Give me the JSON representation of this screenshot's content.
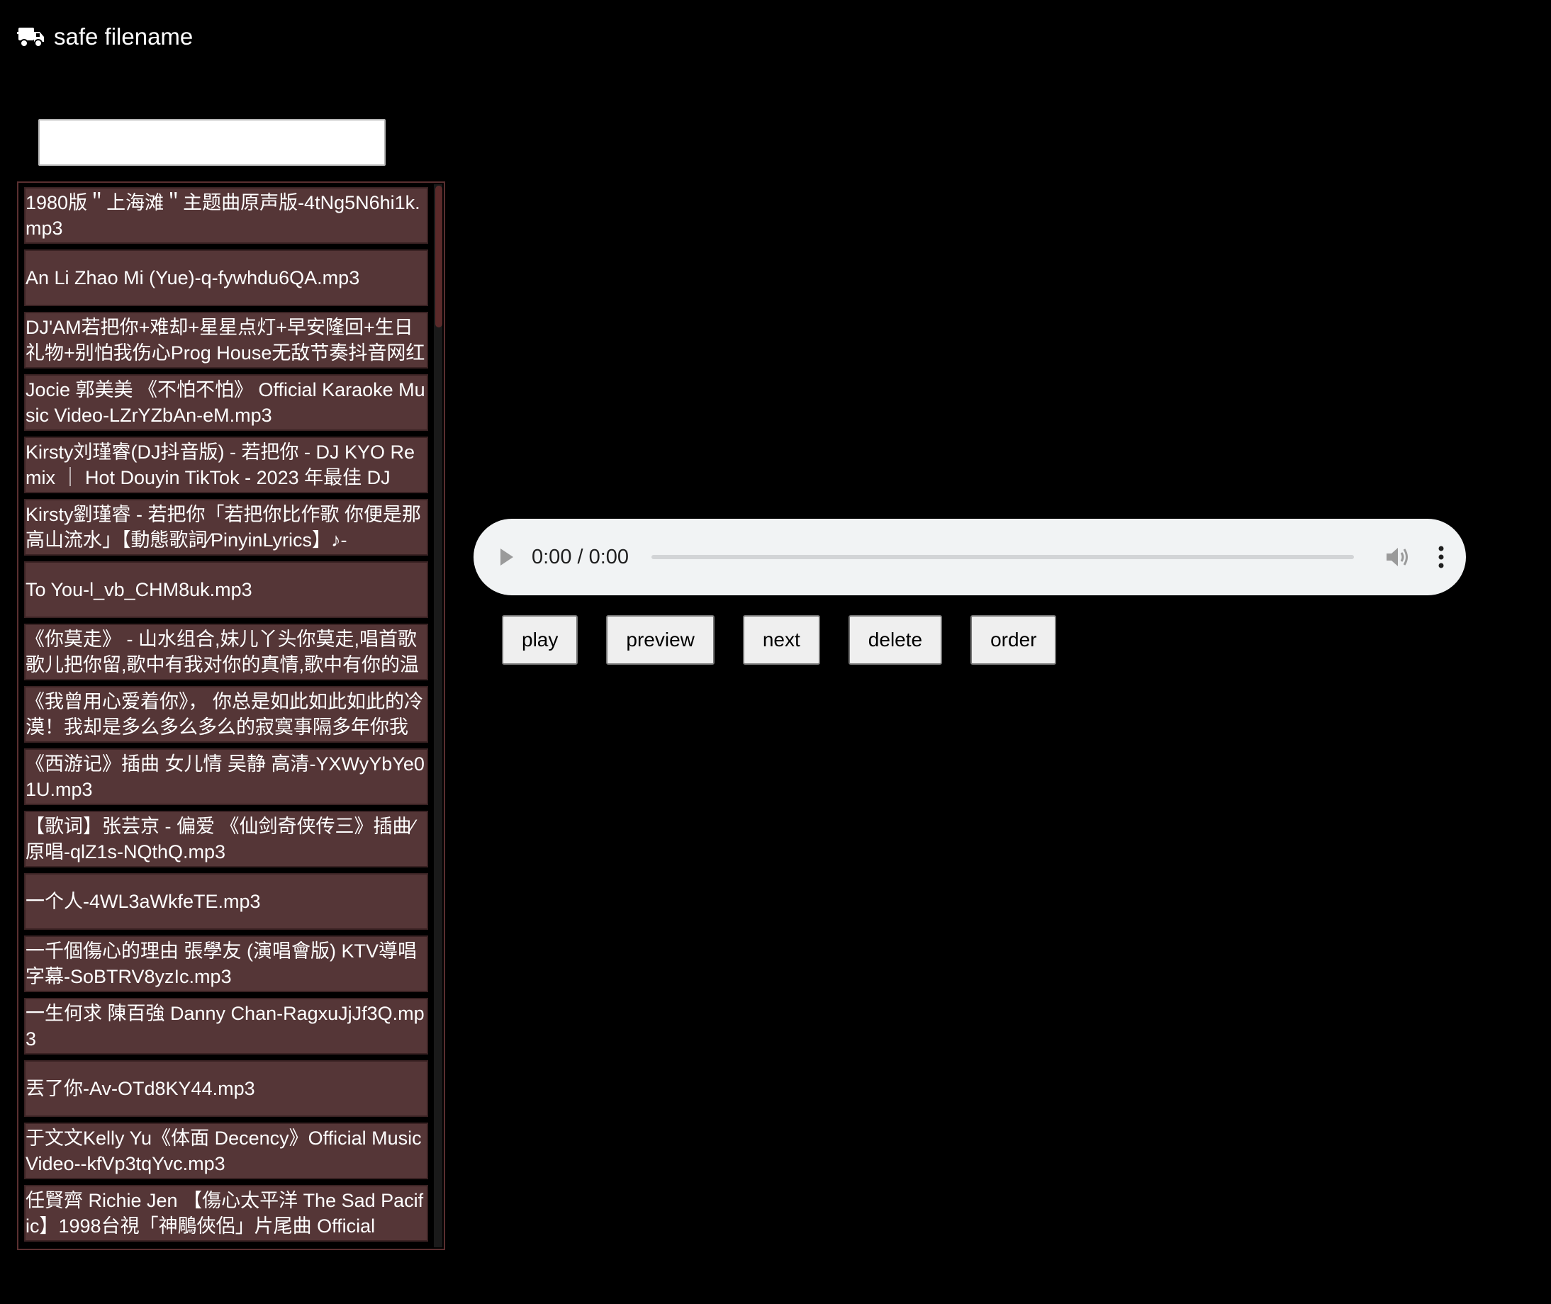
{
  "header": {
    "title": "safe filename",
    "icon": "truck-icon"
  },
  "search": {
    "value": "",
    "placeholder": ""
  },
  "playlist": {
    "items": [
      {
        "label": "1980版＂上海滩＂主题曲原声版-4tNg5N6hi1k.mp3"
      },
      {
        "label": "An Li Zhao Mi (Yue)-q-fywhdu6QA.mp3"
      },
      {
        "label": "DJ'AM若把你+难却+星星点灯+早安隆回+生日礼物+别怕我伤心Prog House无敌节奏抖音网红歌"
      },
      {
        "label": "Jocie 郭美美 《不怕不怕》 Official Karaoke Music Video-LZrYZbAn-eM.mp3"
      },
      {
        "label": "Kirsty刘瑾睿(DJ抖音版) - 若把你 - DJ KYO Remix ｜ Hot Douyin TikTok - 2023 年最佳 DJ"
      },
      {
        "label": "Kirsty劉瑾睿 - 若把你「若把你比作歌 你便是那高山流水」【動態歌詞⁄PinyinLyrics】♪-"
      },
      {
        "label": "To You-l_vb_CHM8uk.mp3"
      },
      {
        "label": "《你莫走》 - 山水组合,妹儿丫头你莫走,唱首歌歌儿把你留,歌中有我对你的真情,歌中有你的温"
      },
      {
        "label": "《我曾用心爱着你》， 你总是如此如此如此的冷漠！我却是多么多么多么的寂寞事隔多年你我各"
      },
      {
        "label": "《西游记》插曲 女儿情 吴静 高清-YXWyYbYe01U.mp3"
      },
      {
        "label": "【歌词】张芸京 - 偏爱 《仙剑奇侠传三》插曲⁄原唱-qlZ1s-NQthQ.mp3"
      },
      {
        "label": "一个人-4WL3aWkfeTE.mp3"
      },
      {
        "label": "一千個傷心的理由 張學友 (演唱會版) KTV導唱字幕-SoBTRV8yzIc.mp3"
      },
      {
        "label": "一生何求 陳百強 Danny Chan-RagxuJjJf3Q.mp3"
      },
      {
        "label": "丟了你-Av-OTd8KY44.mp3"
      },
      {
        "label": "于文文Kelly Yu《体面 Decency》Official Music Video--kfVp3tqYvc.mp3"
      },
      {
        "label": "任賢齊 Richie Jen 【傷心太平洋 The Sad Pacific】1998台視「神鵰俠侶」片尾曲 Official"
      }
    ]
  },
  "player": {
    "time": "0:00 / 0:00",
    "progress": 0
  },
  "controls": {
    "play": "play",
    "preview": "preview",
    "next": "next",
    "delete": "delete",
    "order": "order"
  },
  "colors": {
    "background": "#000000",
    "track_bg": "#553637",
    "playlist_border": "#5a2f30"
  }
}
